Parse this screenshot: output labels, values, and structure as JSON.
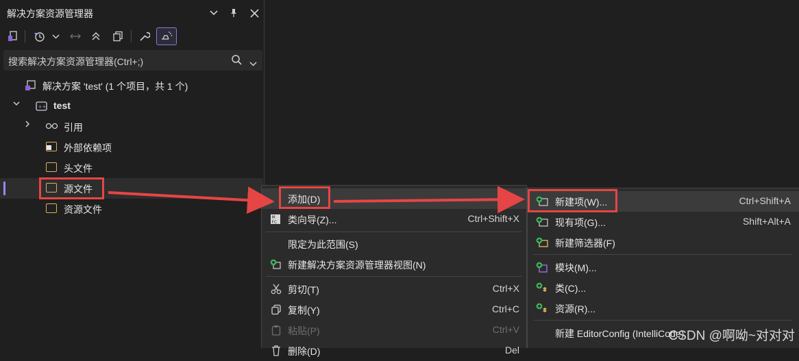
{
  "panel": {
    "title": "解决方案资源管理器",
    "search_placeholder": "搜索解决方案资源管理器(Ctrl+;)"
  },
  "tree": {
    "solution": "解决方案 'test' (1 个项目，共 1 个)",
    "project": "test",
    "references": "引用",
    "external_deps": "外部依赖项",
    "header_files": "头文件",
    "source_files": "源文件",
    "resource_files": "资源文件"
  },
  "context_menu": {
    "items": [
      {
        "label": "添加(D)",
        "shortcut": "",
        "submenu_arrow": "›"
      },
      {
        "label": "类向导(Z)...",
        "shortcut": "Ctrl+Shift+X"
      },
      {
        "label": "限定为此范围(S)",
        "shortcut": ""
      },
      {
        "label": "新建解决方案资源管理器视图(N)",
        "shortcut": ""
      },
      {
        "label": "剪切(T)",
        "shortcut": "Ctrl+X"
      },
      {
        "label": "复制(Y)",
        "shortcut": "Ctrl+C"
      },
      {
        "label": "粘贴(P)",
        "shortcut": "Ctrl+V"
      },
      {
        "label": "删除(D)",
        "shortcut": "Del"
      }
    ]
  },
  "submenu": {
    "items": [
      {
        "label": "新建项(W)...",
        "shortcut": "Ctrl+Shift+A"
      },
      {
        "label": "现有项(G)...",
        "shortcut": "Shift+Alt+A"
      },
      {
        "label": "新建筛选器(F)",
        "shortcut": ""
      },
      {
        "label": "模块(M)...",
        "shortcut": ""
      },
      {
        "label": "类(C)...",
        "shortcut": ""
      },
      {
        "label": "资源(R)...",
        "shortcut": ""
      },
      {
        "label": "新建 EditorConfig (IntelliCode)",
        "shortcut": ""
      }
    ]
  },
  "watermark": "CSDN @啊呦~对对对",
  "colors": {
    "highlight_box": "#e64545",
    "arrow": "#e64545",
    "selection_accent": "#9d86ff",
    "add_icon": "#3fbf5f",
    "folder_icon": "#d8b25f"
  }
}
